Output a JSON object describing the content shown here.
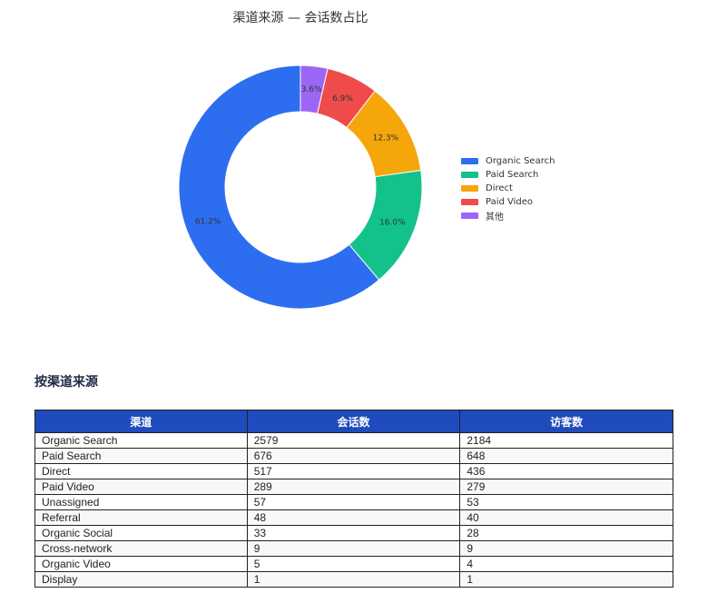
{
  "chart_data": {
    "type": "pie",
    "title": "渠道来源 — 会话数占比",
    "hole": true,
    "legend_position": "right",
    "slices": [
      {
        "label": "Organic Search",
        "percent": 61.2,
        "percent_label": "61.2%",
        "color": "#2d6ef0"
      },
      {
        "label": "Paid Search",
        "percent": 16.0,
        "percent_label": "16.0%",
        "color": "#12c28a"
      },
      {
        "label": "Direct",
        "percent": 12.3,
        "percent_label": "12.3%",
        "color": "#f5a60b"
      },
      {
        "label": "Paid Video",
        "percent": 6.9,
        "percent_label": "6.9%",
        "color": "#ef4b4b"
      },
      {
        "label": "其他",
        "percent": 3.6,
        "percent_label": "3.6%",
        "color": "#9b66f5"
      }
    ]
  },
  "table_section": {
    "title": "按渠道来源",
    "headers": [
      "渠道",
      "会话数",
      "访客数"
    ],
    "rows": [
      [
        "Organic Search",
        "2579",
        "2184"
      ],
      [
        "Paid Search",
        "676",
        "648"
      ],
      [
        "Direct",
        "517",
        "436"
      ],
      [
        "Paid Video",
        "289",
        "279"
      ],
      [
        "Unassigned",
        "57",
        "53"
      ],
      [
        "Referral",
        "48",
        "40"
      ],
      [
        "Organic Social",
        "33",
        "28"
      ],
      [
        "Cross-network",
        "9",
        "9"
      ],
      [
        "Organic Video",
        "5",
        "4"
      ],
      [
        "Display",
        "1",
        "1"
      ]
    ]
  }
}
